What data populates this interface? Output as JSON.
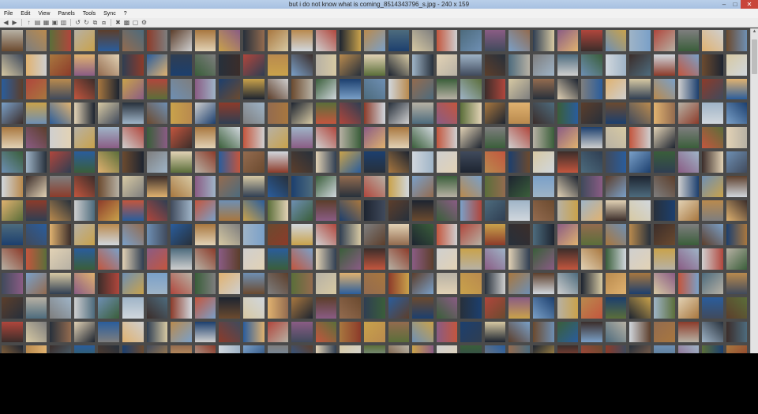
{
  "window": {
    "title": "but i do not know what is coming_8514343796_s.jpg - 240 x 159",
    "controls": {
      "minimize": "–",
      "maximize": "□",
      "close": "✕"
    }
  },
  "menu": {
    "items": [
      "File",
      "Edit",
      "View",
      "Panels",
      "Tools",
      "Sync",
      "?"
    ]
  },
  "toolbar": {
    "icons": [
      {
        "name": "back-icon",
        "glyph": "◀"
      },
      {
        "name": "forward-icon",
        "glyph": "▶"
      },
      {
        "name": "up-icon",
        "glyph": "↑"
      },
      {
        "name": "open-folder-icon",
        "glyph": "▤"
      },
      {
        "name": "folder-icon",
        "glyph": "▦"
      },
      {
        "name": "save-icon",
        "glyph": "▣"
      },
      {
        "name": "print-icon",
        "glyph": "▥"
      },
      {
        "name": "rotate-left-icon",
        "glyph": "↺"
      },
      {
        "name": "rotate-right-icon",
        "glyph": "↻"
      },
      {
        "name": "copy-icon",
        "glyph": "⧉"
      },
      {
        "name": "move-icon",
        "glyph": "⧈"
      },
      {
        "name": "delete-icon",
        "glyph": "✖"
      },
      {
        "name": "slideshow-icon",
        "glyph": "▩"
      },
      {
        "name": "fullscreen-icon",
        "glyph": "▢"
      },
      {
        "name": "settings-icon",
        "glyph": "⚙"
      }
    ]
  },
  "scrollbar": {
    "up_glyph": "▲"
  },
  "thumbnail_palette": [
    "#6b4a2f",
    "#a8773f",
    "#2f3e52",
    "#b7b1a4",
    "#1d2430",
    "#6e8fb3",
    "#8c3b2a",
    "#d7c9a3",
    "#3a5e3a",
    "#c9a24b",
    "#404a5c",
    "#7e7e7e",
    "#d1d7dd",
    "#8a5c84",
    "#2a5d9c",
    "#b98a4e",
    "#9fb4c7",
    "#5c3e2b",
    "#c3563e",
    "#e0b270",
    "#27303b",
    "#7aa0c8",
    "#5b6e3a",
    "#cfcfcf",
    "#3b2d2a",
    "#936b4f",
    "#1c3f6e",
    "#b0463c",
    "#e2d2b5",
    "#4d6b7d"
  ]
}
